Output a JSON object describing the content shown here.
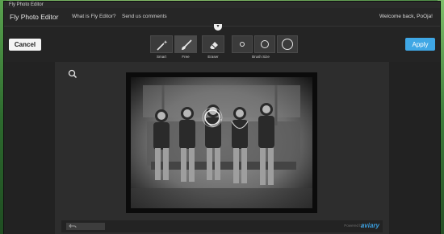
{
  "window": {
    "title": "Fly Photo Editor"
  },
  "header": {
    "app_name": "Fly Photo Editor",
    "nav": [
      {
        "label": "What is Fly Editor?"
      },
      {
        "label": "Send us comments"
      }
    ],
    "welcome": "Welcome back, PoOja!"
  },
  "toolbar": {
    "cancel_label": "Cancel",
    "apply_label": "Apply",
    "tools": [
      {
        "label": "Smart",
        "icon": "magic-wand-icon"
      },
      {
        "label": "Free",
        "icon": "brush-icon"
      },
      {
        "label": "Eraser",
        "icon": "eraser-icon"
      }
    ],
    "brush_size_label": "Brush Size",
    "brush_sizes": [
      "small",
      "medium",
      "large"
    ]
  },
  "footer": {
    "powered_by": "Powered by",
    "brand": "aviary"
  },
  "colors": {
    "accent": "#3fa7e5",
    "background": "#1f1f1f"
  }
}
